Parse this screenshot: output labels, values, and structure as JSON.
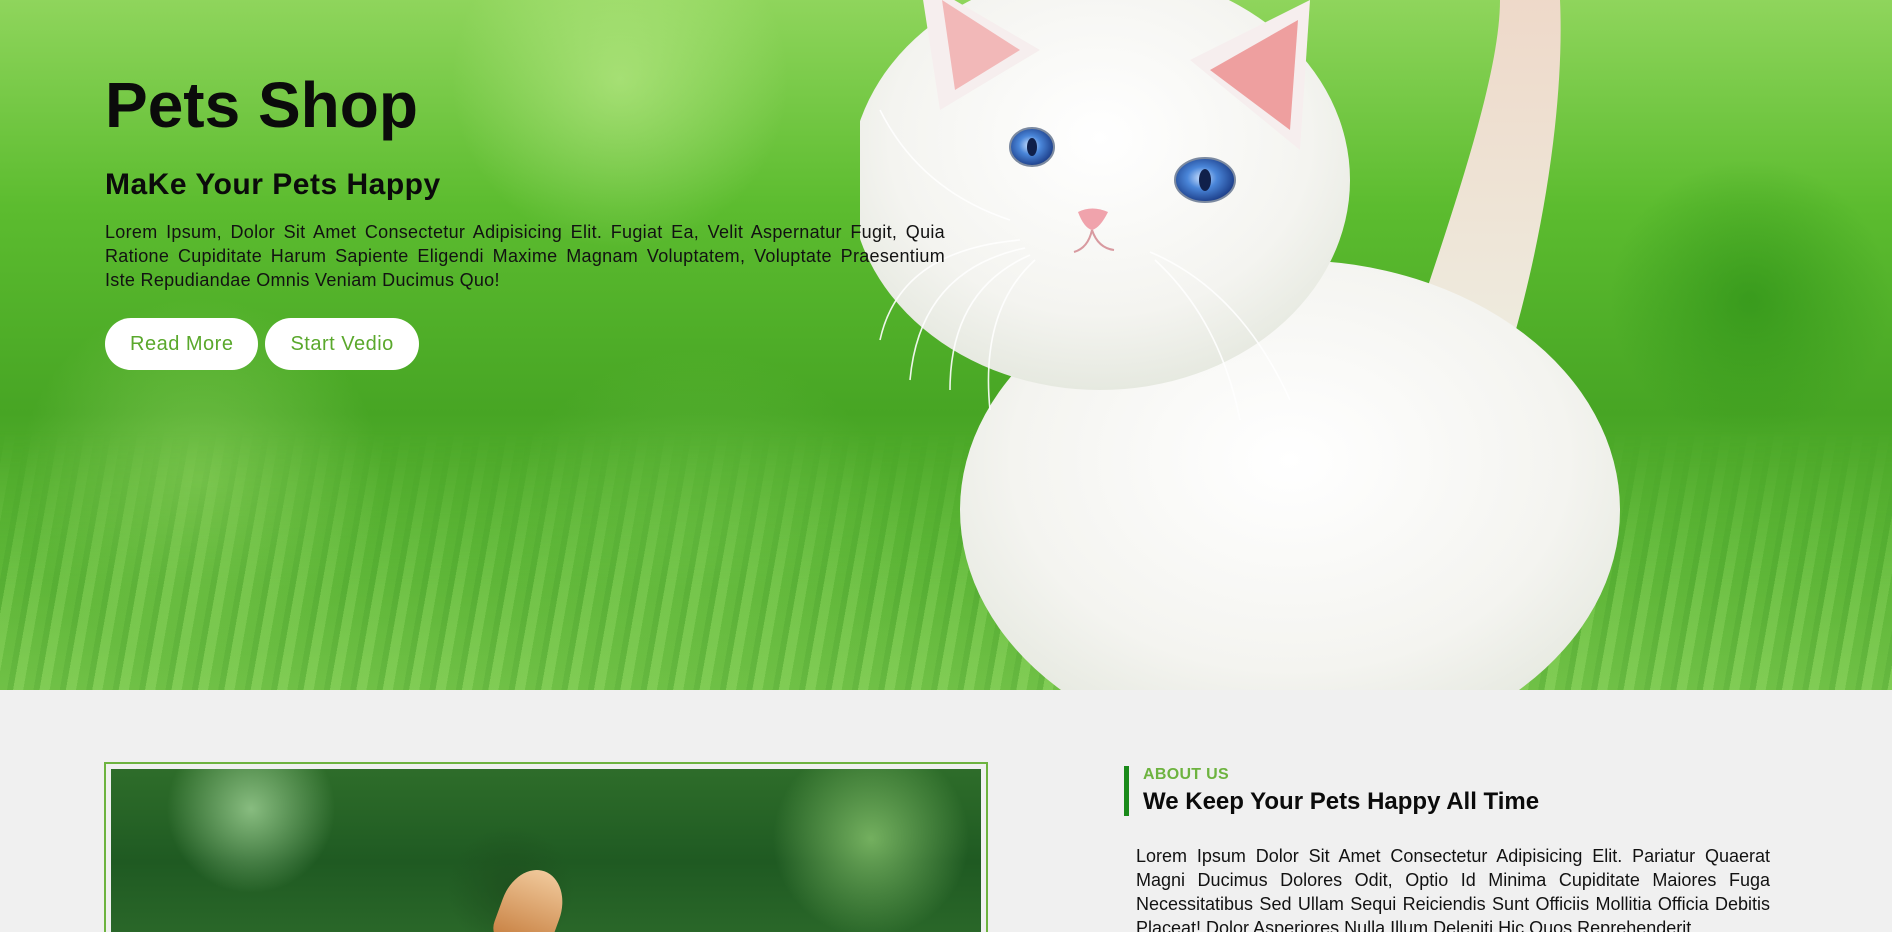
{
  "hero": {
    "title": "Pets Shop",
    "subtitle": "MaKe Your Pets Happy",
    "description": "Lorem Ipsum, Dolor Sit Amet Consectetur Adipisicing Elit. Fugiat Ea, Velit Aspernatur Fugit, Quia Ratione Cupiditate Harum Sapiente Eligendi Maxime Magnam Voluptatem, Voluptate Praesentium Iste Repudiandae Omnis Veniam Ducimus Quo!",
    "buttons": {
      "read_more": "Read More",
      "start_video": "Start Vedio"
    }
  },
  "about": {
    "label": "ABOUT US",
    "title": "We Keep Your Pets Happy All Time",
    "description": "Lorem Ipsum Dolor Sit Amet Consectetur Adipisicing Elit. Pariatur Quaerat Magni Ducimus Dolores Odit, Optio Id Minima Cupiditate Maiores Fuga Necessitatibus Sed Ullam Sequi Reiciendis Sunt Officiis Mollitia Officia Debitis Placeat! Dolor Asperiores Nulla Illum Deleniti Hic Quos Reprehenderit"
  },
  "colors": {
    "accent": "#6db33f",
    "accent_dark": "#1a8a1a",
    "button_text": "#5aa82c",
    "section_bg": "#f0f0f0"
  },
  "images": {
    "hero": "white-kitten-on-grass",
    "about": "dog-in-garden"
  }
}
